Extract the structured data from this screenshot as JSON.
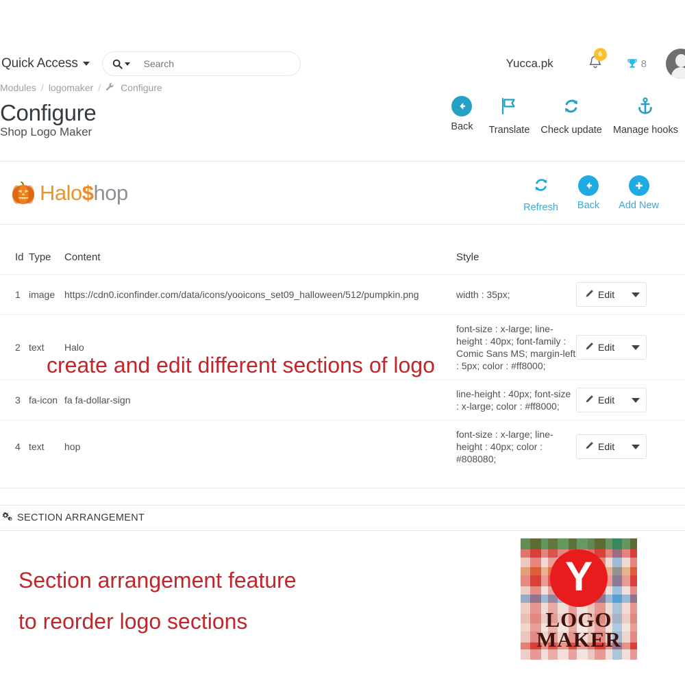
{
  "topbar": {
    "quick_access_label": "Quick Access",
    "search_placeholder": "Search",
    "search_value": "",
    "shop_name": "Yucca.pk",
    "notification_count": "6",
    "trophy_count": "8"
  },
  "breadcrumb": {
    "items": [
      "Modules",
      "logomaker",
      "Configure"
    ],
    "separator": "/"
  },
  "page": {
    "title": "Configure",
    "subtitle": "Shop Logo Maker"
  },
  "header_toolbar": [
    {
      "label": "Back",
      "icon": "arrow-left-circle-icon"
    },
    {
      "label": "Translate",
      "icon": "flag-icon"
    },
    {
      "label": "Check update",
      "icon": "refresh-icon"
    },
    {
      "label": "Manage hooks",
      "icon": "anchor-icon"
    }
  ],
  "logo_preview": {
    "part_halo": "Halo",
    "part_dollar": "$",
    "part_hop": "hop",
    "icon": "pumpkin-icon",
    "colors": {
      "orange": "#e8952f",
      "gray": "#8d9197"
    }
  },
  "panel_actions": [
    {
      "label": "Refresh",
      "icon": "refresh-icon"
    },
    {
      "label": "Back",
      "icon": "arrow-left-circle-icon"
    },
    {
      "label": "Add New",
      "icon": "plus-circle-icon"
    }
  ],
  "table": {
    "headers": [
      "Id",
      "Type",
      "Content",
      "Style",
      ""
    ],
    "action_label": "Edit",
    "rows": [
      {
        "id": "1",
        "type": "image",
        "content": "https://cdn0.iconfinder.com/data/icons/yooicons_set09_halloween/512/pumpkin.png",
        "style": "width : 35px;"
      },
      {
        "id": "2",
        "type": "text",
        "content": "Halo",
        "style": "font-size : x-large; line-height : 40px; font-family : Comic Sans MS; margin-left : 5px; color : #ff8000;"
      },
      {
        "id": "3",
        "type": "fa-icon",
        "content": "fa fa-dollar-sign",
        "style": "line-height : 40px; font-size : x-large; color : #ff8000;"
      },
      {
        "id": "4",
        "type": "text",
        "content": "hop",
        "style": "font-size : x-large; line-height : 40px; color : #808080;"
      }
    ]
  },
  "section_arrangement": {
    "title": "SECTION ARRANGEMENT",
    "icon": "gears-icon"
  },
  "annotations": {
    "color": "#c0262b",
    "line_1": "create and edit different sections of logo",
    "line_2": "Section arrangement feature",
    "line_3": "to reorder logo sections"
  },
  "logo_maker_badge": {
    "letter": "Y",
    "word_1": "LOGO",
    "word_2": "MAKER",
    "circle_color": "#e81c1c"
  }
}
